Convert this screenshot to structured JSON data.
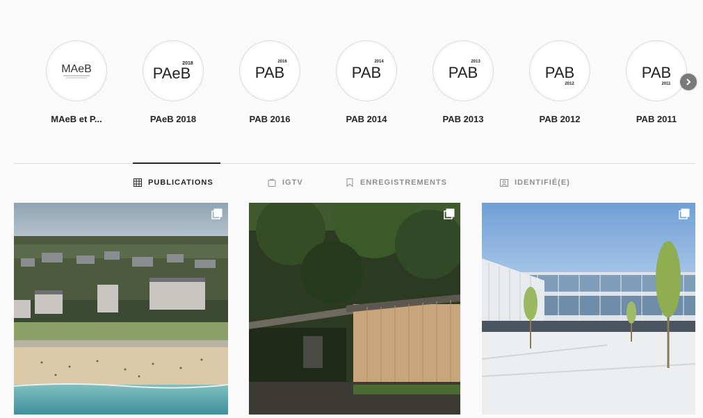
{
  "highlights": [
    {
      "label": "MAeB et P...",
      "logo_main": "MAeB"
    },
    {
      "label": "PAeB 2018",
      "logo_main": "PAeB",
      "logo_year": "2018"
    },
    {
      "label": "PAB 2016",
      "logo_main": "PAB",
      "logo_year": "2016"
    },
    {
      "label": "PAB 2014",
      "logo_main": "PAB",
      "logo_year": "2014"
    },
    {
      "label": "PAB 2013",
      "logo_main": "PAB",
      "logo_year": "2013"
    },
    {
      "label": "PAB 2012",
      "logo_main": "PAB",
      "logo_year": "2012"
    },
    {
      "label": "PAB 2011",
      "logo_main": "PAB",
      "logo_year": "2011"
    }
  ],
  "next_icon": "chevron-right-icon",
  "tabs": [
    {
      "label": "PUBLICATIONS",
      "icon": "grid-icon",
      "active": true
    },
    {
      "label": "IGTV",
      "icon": "igtv-icon",
      "active": false
    },
    {
      "label": "ENREGISTREMENTS",
      "icon": "bookmark-icon",
      "active": false
    },
    {
      "label": "IDENTIFIÉ(E)",
      "icon": "tagged-icon",
      "active": false
    }
  ],
  "posts": [
    {
      "subject": "coastal-town-beach-aerial",
      "multi": true
    },
    {
      "subject": "wooden-building-forest",
      "multi": true
    },
    {
      "subject": "modern-glass-building-plaza",
      "multi": true
    }
  ],
  "colors": {
    "text": "#262626",
    "muted": "#8e8e8e",
    "border": "#dbdbdb",
    "background": "#fafafa"
  }
}
